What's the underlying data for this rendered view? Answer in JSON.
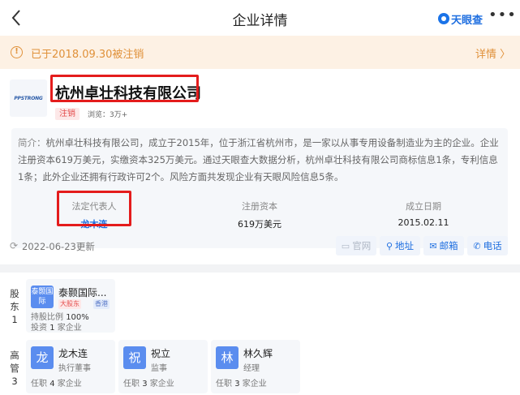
{
  "nav": {
    "title": "企业详情",
    "brand": "天眼查",
    "more": "•••"
  },
  "notice": {
    "text": "已于2018.09.30被注销",
    "link": "详情 〉"
  },
  "company": {
    "logo_text": "PPSTRONG",
    "name": "杭州卓壮科技有限公司",
    "status_tag": "注销",
    "views": "浏览：3万+"
  },
  "intro": {
    "label": "简介：",
    "text": "杭州卓壮科技有限公司，成立于2015年，位于浙江省杭州市，是一家以从事专用设备制造业为主的企业。企业注册资本619万美元，实缴资本325万美元。通过天眼查大数据分析，杭州卓壮科技有限公司商标信息1条，专利信息1条；此外企业还拥有行政许可2个。风险方面共发现企业有天眼风险信息5条。"
  },
  "stats": [
    {
      "label": "法定代表人",
      "value": "龙木连"
    },
    {
      "label": "注册资本",
      "value": "619万美元"
    },
    {
      "label": "成立日期",
      "value": "2015.02.11"
    }
  ],
  "update": {
    "text": "2022-06-23更新"
  },
  "actions": [
    {
      "label": "官网"
    },
    {
      "label": "地址"
    },
    {
      "label": "邮箱"
    },
    {
      "label": "电话"
    }
  ],
  "shareholders": {
    "section_label": "股东1",
    "items": [
      {
        "avatar_text": "泰颢国际",
        "name": "泰颢国际...",
        "badges": [
          "大股东",
          "香港"
        ],
        "ratio_label": "持股比例",
        "ratio_value": "100%",
        "invest_prefix": "投资",
        "invest_count": "1",
        "invest_suffix": "家企业"
      }
    ]
  },
  "executives": {
    "section_label": "高管3",
    "items": [
      {
        "avatar_text": "龙",
        "name": "龙木连",
        "role": "执行董事",
        "prefix": "任职",
        "count": "4",
        "suffix": "家企业"
      },
      {
        "avatar_text": "祝",
        "name": "祝立",
        "role": "监事",
        "prefix": "任职",
        "count": "3",
        "suffix": "家企业"
      },
      {
        "avatar_text": "林",
        "name": "林久辉",
        "role": "经理",
        "prefix": "任职",
        "count": "3",
        "suffix": "家企业"
      }
    ]
  },
  "colors": {
    "accent": "#1f6fe0",
    "notice": "#e0913a",
    "highlight": "#e41c1c"
  }
}
